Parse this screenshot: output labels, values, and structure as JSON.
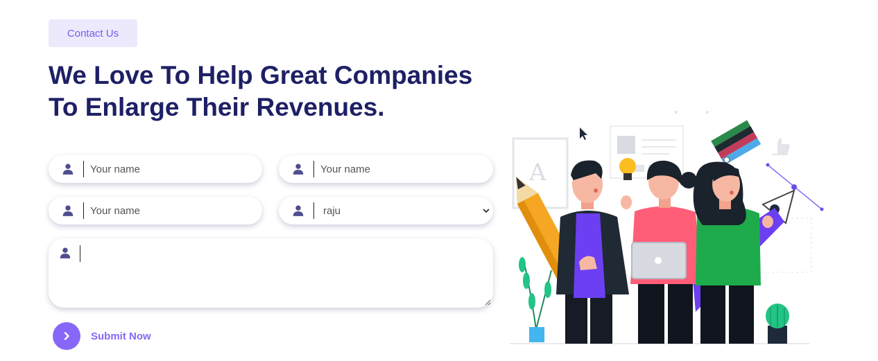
{
  "badge": {
    "label": "Contact Us"
  },
  "headline": {
    "line1": "We Love To Help Great Companies",
    "line2": "To Enlarge Their Revenues."
  },
  "form": {
    "field1": {
      "placeholder": "Your name",
      "icon": "user-icon"
    },
    "field2": {
      "placeholder": "Your name",
      "icon": "user-icon"
    },
    "field3": {
      "placeholder": "Your name",
      "icon": "user-icon"
    },
    "select": {
      "value": "raju",
      "icon": "user-icon"
    },
    "message": {
      "icon": "user-icon"
    }
  },
  "submit": {
    "label": "Submit Now",
    "icon": "chevron-right-icon"
  },
  "colors": {
    "accent": "#8667f7",
    "headline": "#1e2065",
    "badge_bg": "#ece9fd"
  }
}
